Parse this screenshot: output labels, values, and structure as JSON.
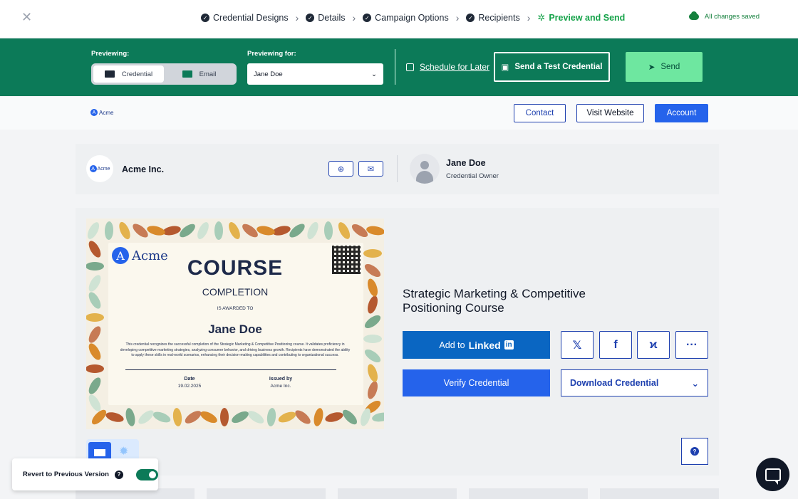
{
  "steps": [
    {
      "label": "Credential Designs"
    },
    {
      "label": "Details"
    },
    {
      "label": "Campaign Options"
    },
    {
      "label": "Recipients"
    },
    {
      "label": "Preview and Send"
    }
  ],
  "status": {
    "saved": "All changes saved"
  },
  "controls": {
    "previewing_label": "Previewing:",
    "mode_credential": "Credential",
    "mode_email": "Email",
    "previewing_for_label": "Previewing for:",
    "recipient": "Jane Doe",
    "schedule": "Schedule for Later",
    "test": "Send a Test Credential",
    "send": "Send"
  },
  "page_header": {
    "logo": "Acme",
    "contact": "Contact",
    "visit": "Visit Website",
    "account": "Account"
  },
  "issuer": {
    "logo": "Acme",
    "name": "Acme Inc.",
    "owner_name": "Jane Doe",
    "owner_role": "Credential Owner"
  },
  "certificate": {
    "logo": "Acme",
    "title": "COURSE",
    "subtitle": "COMPLETION",
    "awarded": "IS AWARDED TO",
    "recipient": "Jane Doe",
    "description": "This credential recognizes the successful completion of the Strategic Marketing & Competitive Positioning course. It validates proficiency in developing competitive marketing strategies, analyzing consumer behavior, and driving business growth. Recipients have demonstrated the ability to apply these skills in real-world scenarios, enhancing their decision-making capabilities and contributing to organizational success.",
    "date_label": "Date",
    "date_value": "19.02.2025",
    "issued_label": "Issued by",
    "issued_value": "Acme Inc."
  },
  "credential": {
    "title": "Strategic Marketing & Competitive Positioning Course",
    "add_to": "Add to",
    "linkedin": "Linked",
    "linkedin_in": "in",
    "verify": "Verify Credential",
    "download": "Download Credential"
  },
  "footer": {
    "revert": "Revert to Previous Version"
  },
  "colors": {
    "brand_green": "#0c7a58",
    "primary_blue": "#2563eb",
    "linkedin": "#0a66c2"
  }
}
